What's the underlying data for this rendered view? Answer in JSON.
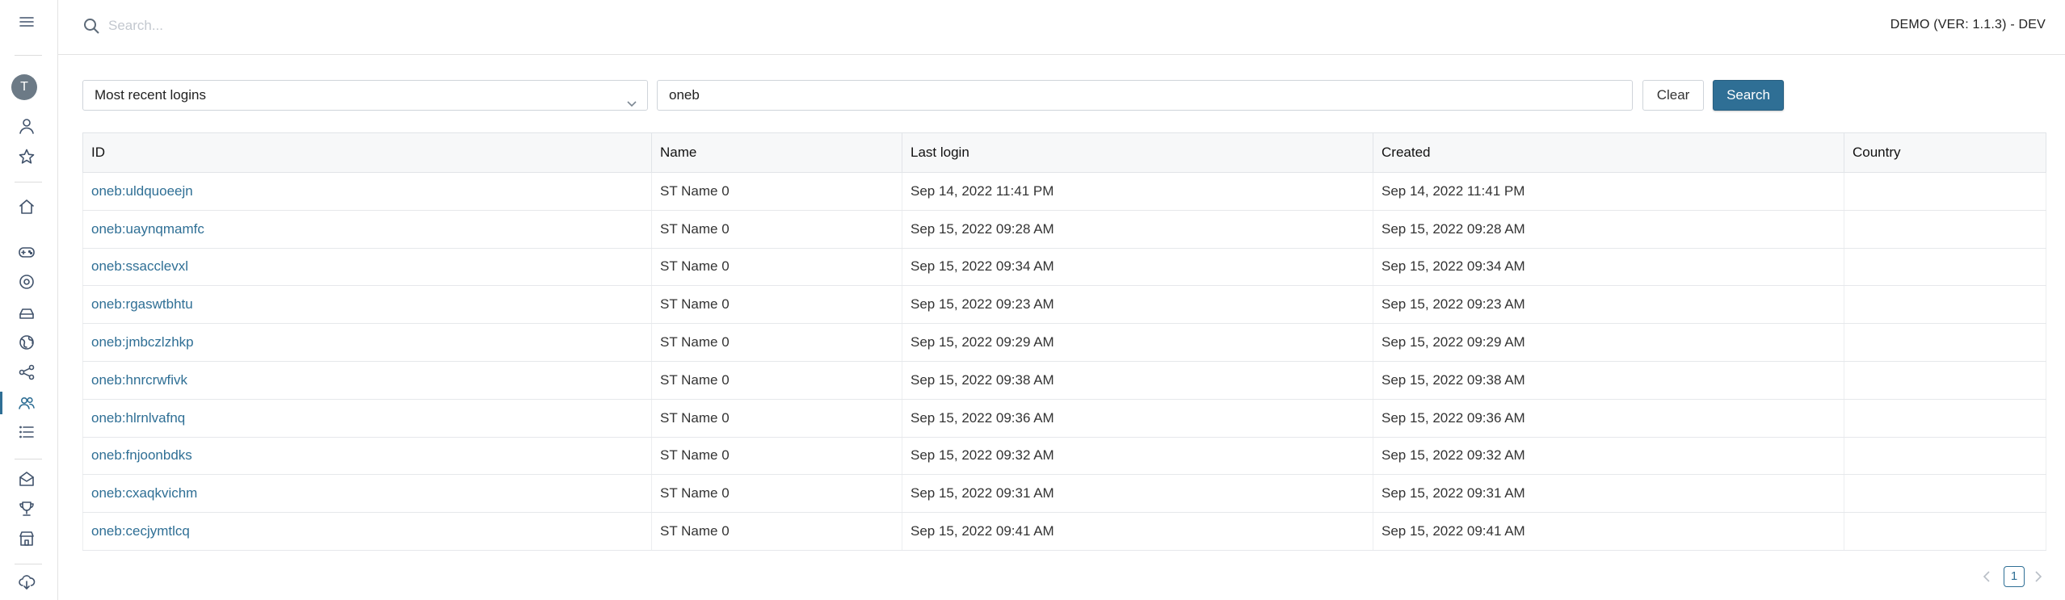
{
  "header": {
    "search_placeholder": "Search...",
    "env_label": "DEMO (VER: 1.1.3) - DEV"
  },
  "sidebar": {
    "avatar_initial": "T",
    "icons": [
      "menu-icon",
      "user-icon",
      "star-icon",
      "home-icon",
      "gamepad-icon",
      "settings-icon",
      "storage-icon",
      "globe-icon",
      "share-icon",
      "users-icon",
      "list-icon",
      "inbox-icon",
      "trophy-icon",
      "store-icon",
      "cloud-download-icon"
    ],
    "active_item": "users-icon"
  },
  "filters": {
    "select_value": "Most recent logins",
    "query_value": "oneb",
    "clear_label": "Clear",
    "search_label": "Search"
  },
  "table": {
    "columns": [
      "ID",
      "Name",
      "Last login",
      "Created",
      "Country"
    ],
    "rows": [
      {
        "id": "oneb:uldquoeejn",
        "name": "ST Name 0",
        "last_login": "Sep 14, 2022 11:41 PM",
        "created": "Sep 14, 2022 11:41 PM",
        "country": ""
      },
      {
        "id": "oneb:uaynqmamfc",
        "name": "ST Name 0",
        "last_login": "Sep 15, 2022 09:28 AM",
        "created": "Sep 15, 2022 09:28 AM",
        "country": ""
      },
      {
        "id": "oneb:ssacclevxl",
        "name": "ST Name 0",
        "last_login": "Sep 15, 2022 09:34 AM",
        "created": "Sep 15, 2022 09:34 AM",
        "country": ""
      },
      {
        "id": "oneb:rgaswtbhtu",
        "name": "ST Name 0",
        "last_login": "Sep 15, 2022 09:23 AM",
        "created": "Sep 15, 2022 09:23 AM",
        "country": ""
      },
      {
        "id": "oneb:jmbczlzhkp",
        "name": "ST Name 0",
        "last_login": "Sep 15, 2022 09:29 AM",
        "created": "Sep 15, 2022 09:29 AM",
        "country": ""
      },
      {
        "id": "oneb:hnrcrwfivk",
        "name": "ST Name 0",
        "last_login": "Sep 15, 2022 09:38 AM",
        "created": "Sep 15, 2022 09:38 AM",
        "country": ""
      },
      {
        "id": "oneb:hlrnlvafnq",
        "name": "ST Name 0",
        "last_login": "Sep 15, 2022 09:36 AM",
        "created": "Sep 15, 2022 09:36 AM",
        "country": ""
      },
      {
        "id": "oneb:fnjoonbdks",
        "name": "ST Name 0",
        "last_login": "Sep 15, 2022 09:32 AM",
        "created": "Sep 15, 2022 09:32 AM",
        "country": ""
      },
      {
        "id": "oneb:cxaqkvichm",
        "name": "ST Name 0",
        "last_login": "Sep 15, 2022 09:31 AM",
        "created": "Sep 15, 2022 09:31 AM",
        "country": ""
      },
      {
        "id": "oneb:cecjymtlcq",
        "name": "ST Name 0",
        "last_login": "Sep 15, 2022 09:41 AM",
        "created": "Sep 15, 2022 09:41 AM",
        "country": ""
      }
    ]
  },
  "pagination": {
    "current_page": "1"
  },
  "colors": {
    "accent": "#2f6f95",
    "link": "#2f6f95",
    "sidebar_icon": "#40526b"
  }
}
